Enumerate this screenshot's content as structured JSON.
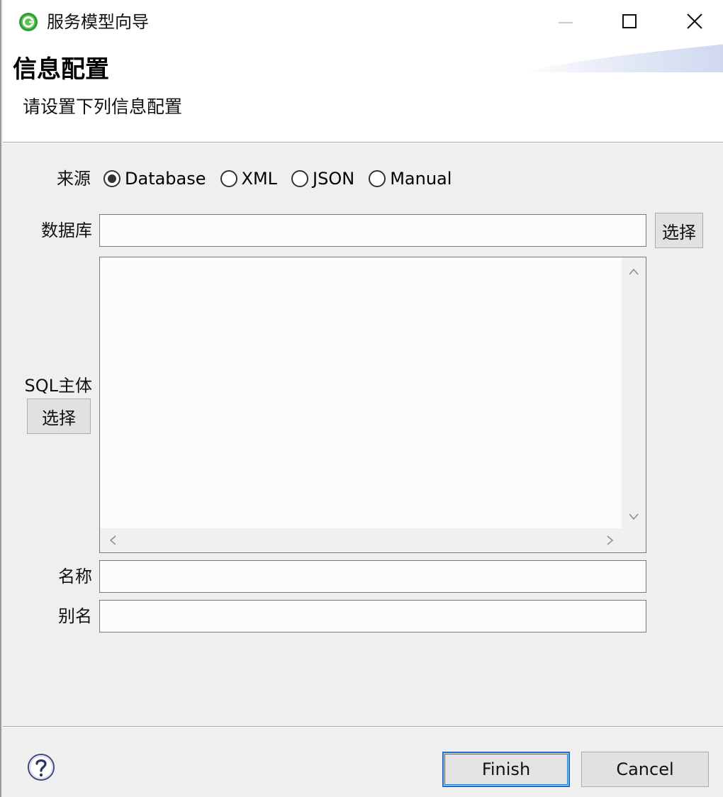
{
  "window": {
    "title": "服务模型向导",
    "icons": {
      "app": "app-logo-icon",
      "minimize": "minimize-icon",
      "maximize": "maximize-icon",
      "close": "close-icon"
    }
  },
  "header": {
    "title": "信息配置",
    "subtitle": "请设置下列信息配置"
  },
  "form": {
    "source": {
      "label": "来源",
      "options": [
        {
          "label": "Database",
          "checked": true
        },
        {
          "label": "XML",
          "checked": false
        },
        {
          "label": "JSON",
          "checked": false
        },
        {
          "label": "Manual",
          "checked": false
        }
      ]
    },
    "database": {
      "label": "数据库",
      "value": "",
      "select_label": "选择"
    },
    "sql": {
      "label": "SQL主体",
      "select_label": "选择",
      "value": ""
    },
    "name": {
      "label": "名称",
      "value": ""
    },
    "alias": {
      "label": "别名",
      "value": ""
    }
  },
  "footer": {
    "help_icon": "help-icon",
    "finish_label": "Finish",
    "cancel_label": "Cancel"
  },
  "colors": {
    "accent": "#1b6fc9",
    "background": "#f0eff0",
    "header_bg": "#ffffff"
  }
}
